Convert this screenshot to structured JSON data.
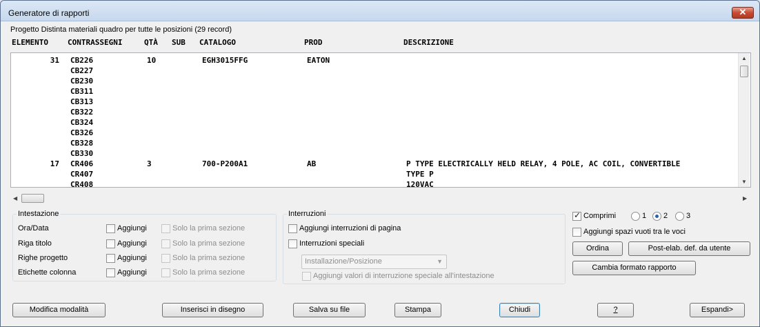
{
  "window": {
    "title": "Generatore di rapporti",
    "close_glyph": "✕"
  },
  "project_line": "Progetto Distinta materiali quadro per tutte le posizioni (29 record)",
  "columns": [
    "ELEMENTO",
    "CONTRASSEGNI",
    "QTÀ",
    "SUB",
    "CATALOGO",
    "PROD",
    "DESCRIZIONE"
  ],
  "report_lines": [
    {
      "elemento": "31",
      "contrassegni": "CB226",
      "qta": "10",
      "sub": "",
      "catalogo": "EGH3015FFG",
      "prod": "EATON",
      "descrizione": ""
    },
    {
      "elemento": "",
      "contrassegni": "CB227",
      "qta": "",
      "sub": "",
      "catalogo": "",
      "prod": "",
      "descrizione": ""
    },
    {
      "elemento": "",
      "contrassegni": "CB230",
      "qta": "",
      "sub": "",
      "catalogo": "",
      "prod": "",
      "descrizione": ""
    },
    {
      "elemento": "",
      "contrassegni": "CB311",
      "qta": "",
      "sub": "",
      "catalogo": "",
      "prod": "",
      "descrizione": ""
    },
    {
      "elemento": "",
      "contrassegni": "CB313",
      "qta": "",
      "sub": "",
      "catalogo": "",
      "prod": "",
      "descrizione": ""
    },
    {
      "elemento": "",
      "contrassegni": "CB322",
      "qta": "",
      "sub": "",
      "catalogo": "",
      "prod": "",
      "descrizione": ""
    },
    {
      "elemento": "",
      "contrassegni": "CB324",
      "qta": "",
      "sub": "",
      "catalogo": "",
      "prod": "",
      "descrizione": ""
    },
    {
      "elemento": "",
      "contrassegni": "CB326",
      "qta": "",
      "sub": "",
      "catalogo": "",
      "prod": "",
      "descrizione": ""
    },
    {
      "elemento": "",
      "contrassegni": "CB328",
      "qta": "",
      "sub": "",
      "catalogo": "",
      "prod": "",
      "descrizione": ""
    },
    {
      "elemento": "",
      "contrassegni": "CB330",
      "qta": "",
      "sub": "",
      "catalogo": "",
      "prod": "",
      "descrizione": ""
    },
    {
      "elemento": "17",
      "contrassegni": "CR406",
      "qta": "3",
      "sub": "",
      "catalogo": "700-P200A1",
      "prod": "AB",
      "descrizione": "P TYPE ELECTRICALLY HELD RELAY, 4 POLE, AC COIL, CONVERTIBLE"
    },
    {
      "elemento": "",
      "contrassegni": "CR407",
      "qta": "",
      "sub": "",
      "catalogo": "",
      "prod": "",
      "descrizione": "TYPE P"
    },
    {
      "elemento": "",
      "contrassegni": "CR408",
      "qta": "",
      "sub": "",
      "catalogo": "",
      "prod": "",
      "descrizione": "120VAC"
    }
  ],
  "intestazione": {
    "title": "Intestazione",
    "rows": [
      {
        "label": "Ora/Data",
        "add": "Aggiungi",
        "first": "Solo la prima sezione",
        "add_checked": false
      },
      {
        "label": "Riga titolo",
        "add": "Aggiungi",
        "first": "Solo la prima sezione",
        "add_checked": false
      },
      {
        "label": "Righe progetto",
        "add": "Aggiungi",
        "first": "Solo la prima sezione",
        "add_checked": false
      },
      {
        "label": "Etichette colonna",
        "add": "Aggiungi",
        "first": "Solo la prima sezione",
        "add_checked": false
      }
    ]
  },
  "interruzioni": {
    "title": "Interruzioni",
    "page_breaks": "Aggiungi interruzioni di pagina",
    "special_breaks": "Interruzioni speciali",
    "dropdown_value": "Installazione/Posizione",
    "add_special_values": "Aggiungi valori di interruzione speciale all'intestazione"
  },
  "options": {
    "comprimi": "Comprimi",
    "comprimi_checked": true,
    "radios": [
      "1",
      "2",
      "3"
    ],
    "radio_selected": "2",
    "add_blank": "Aggiungi spazi vuoti tra le voci"
  },
  "side_buttons": {
    "ordina": "Ordina",
    "post": "Post-elab. def. da utente",
    "format": "Cambia formato rapporto"
  },
  "bottom_buttons": {
    "mode": "Modifica modalità",
    "insert": "Inserisci in disegno",
    "save": "Salva su file",
    "print": "Stampa",
    "close": "Chiudi",
    "help": "?",
    "expand": "Espandi>"
  }
}
